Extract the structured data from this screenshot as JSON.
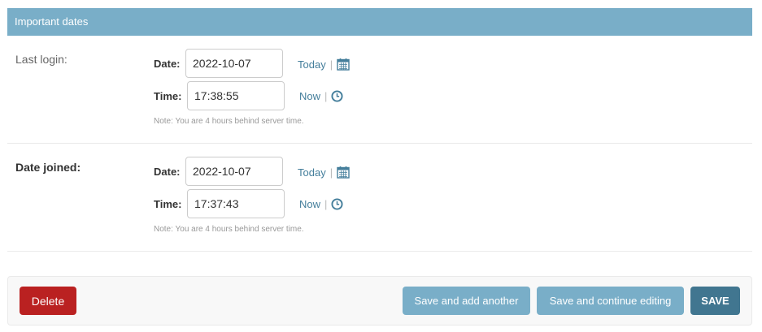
{
  "fieldset": {
    "title": "Important dates"
  },
  "last_login": {
    "label": "Last login:",
    "date_label": "Date:",
    "date_value": "2022-10-07",
    "today_link": "Today",
    "time_label": "Time:",
    "time_value": "17:38:55",
    "now_link": "Now",
    "separator": "|",
    "help": "Note: You are 4 hours behind server time."
  },
  "date_joined": {
    "label": "Date joined:",
    "date_label": "Date:",
    "date_value": "2022-10-07",
    "today_link": "Today",
    "time_label": "Time:",
    "time_value": "17:37:43",
    "now_link": "Now",
    "separator": "|",
    "help": "Note: You are 4 hours behind server time."
  },
  "actions": {
    "delete_label": "Delete",
    "save_add_label": "Save and add another",
    "save_continue_label": "Save and continue editing",
    "save_label": "SAVE"
  },
  "icons": {
    "calendar": "calendar-icon",
    "clock": "clock-icon"
  },
  "colors": {
    "header_bg": "#79aec8",
    "link": "#447e9b",
    "delete_bg": "#ba2121",
    "save_bg": "#417690"
  }
}
